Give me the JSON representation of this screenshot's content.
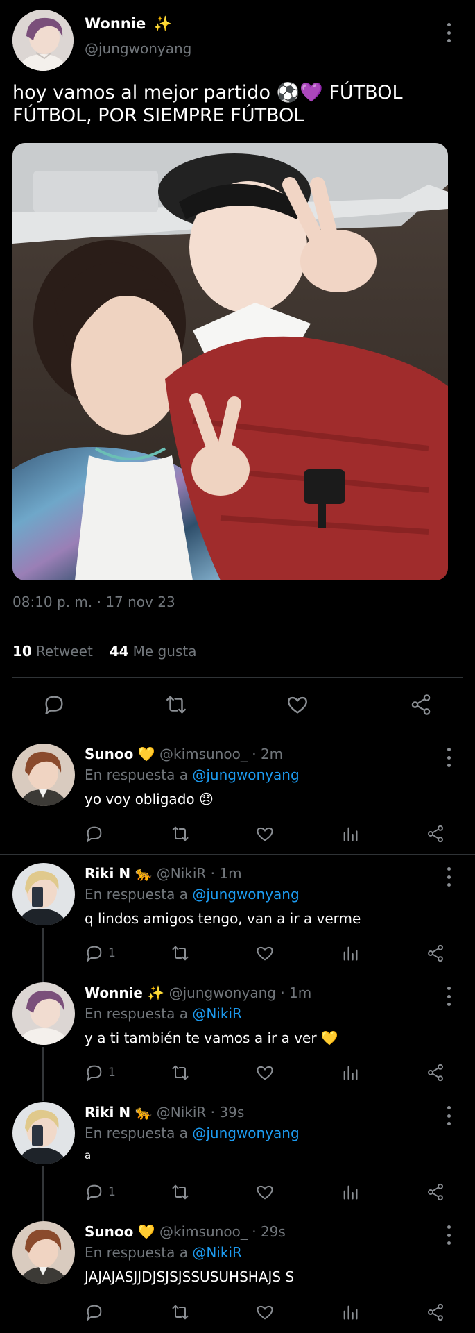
{
  "main_tweet": {
    "name": "Wonnie",
    "name_emoji": "✨",
    "handle": "@jungwonyang",
    "text": "hoy vamos al mejor partido ⚽💜 FÚTBOL FÚTBOL, POR SIEMPRE FÚTBOL",
    "timestamp": "08:10 p. m. · 17 nov 23",
    "retweets": {
      "count": "10",
      "label": "Retweet"
    },
    "likes": {
      "count": "44",
      "label": "Me gusta"
    },
    "actions": [
      "reply-icon",
      "retweet-icon",
      "like-icon",
      "share-icon"
    ]
  },
  "replies": [
    {
      "name": "Sunoo",
      "emoji": "💛",
      "handle": "@kimsunoo_",
      "time": "· 2m",
      "reply_prefix": "En respuesta a",
      "reply_to": "@jungwonyang",
      "text": "yo voy obligado 😞",
      "reply_count": ""
    },
    {
      "name": "Riki N",
      "emoji": "🐆",
      "handle": "@NikiR",
      "time": "· 1m",
      "reply_prefix": "En respuesta a",
      "reply_to": "@jungwonyang",
      "text": "q lindos amigos tengo, van a ir a verme",
      "reply_count": "1"
    },
    {
      "name": "Wonnie",
      "emoji": "✨",
      "handle": "@jungwonyang",
      "time": "· 1m",
      "reply_prefix": "En respuesta a",
      "reply_to": "@NikiR",
      "text": "y a ti también te vamos a ir a ver 💛",
      "reply_count": "1"
    },
    {
      "name": "Riki N",
      "emoji": "🐆",
      "handle": "@NikiR",
      "time": "· 39s",
      "reply_prefix": "En respuesta a",
      "reply_to": "@jungwonyang",
      "text": "a",
      "reply_count": "1"
    },
    {
      "name": "Sunoo",
      "emoji": "💛",
      "handle": "@kimsunoo_",
      "time": "· 29s",
      "reply_prefix": "En respuesta a",
      "reply_to": "@NikiR",
      "text": "JAJAJASJJDJSJSJSSUSUHSHAJS S",
      "reply_count": ""
    }
  ],
  "colors": {
    "background": "#000000",
    "text": "#e7e9ea",
    "muted": "#71767b",
    "link": "#1d9bf0",
    "divider": "#2f3336"
  }
}
